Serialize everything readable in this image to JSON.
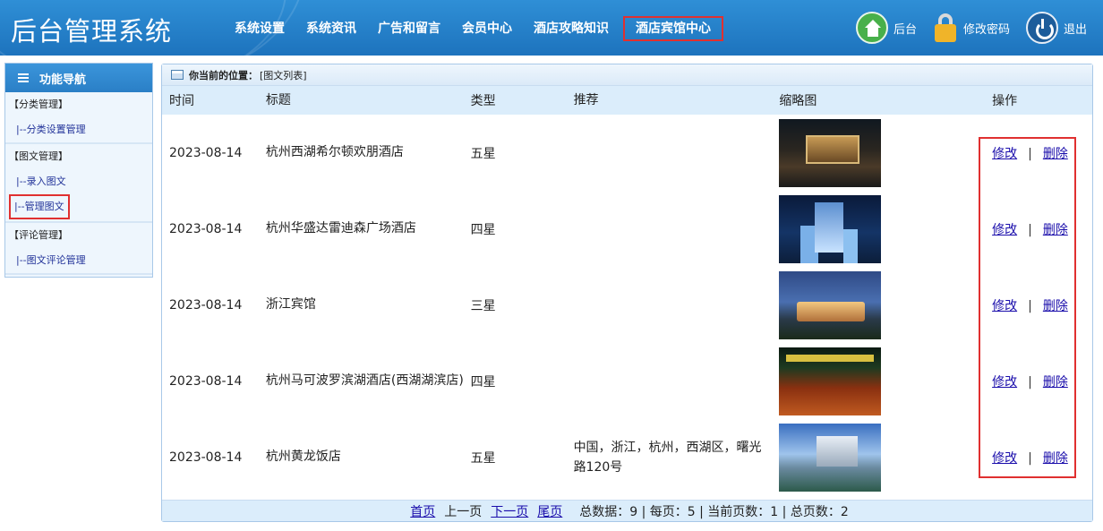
{
  "header": {
    "title": "后台管理系统",
    "nav": [
      "系统设置",
      "系统资讯",
      "广告和留言",
      "会员中心",
      "酒店攻略知识",
      "酒店宾馆中心"
    ],
    "tools": {
      "home": "后台",
      "password": "修改密码",
      "logout": "退出"
    }
  },
  "sidebar": {
    "title": "功能导航",
    "groups": [
      {
        "category": "【分类管理】",
        "links": [
          "|--分类设置管理"
        ]
      },
      {
        "category": "【图文管理】",
        "links": [
          "|--录入图文",
          "|--管理图文"
        ]
      },
      {
        "category": "【评论管理】",
        "links": [
          "|--图文评论管理"
        ]
      }
    ]
  },
  "breadcrumb": {
    "label": "你当前的位置：",
    "value": "[图文列表]"
  },
  "table": {
    "headers": [
      "时间",
      "标题",
      "类型",
      "推荐",
      "缩略图",
      "操作"
    ],
    "rows": [
      {
        "time": "2023-08-14",
        "title": "杭州西湖希尔顿欢朋酒店",
        "type": "五星",
        "recommend": ""
      },
      {
        "time": "2023-08-14",
        "title": "杭州华盛达雷迪森广场酒店",
        "type": "四星",
        "recommend": ""
      },
      {
        "time": "2023-08-14",
        "title": "浙江宾馆",
        "type": "三星",
        "recommend": ""
      },
      {
        "time": "2023-08-14",
        "title": "杭州马可波罗滨湖酒店(西湖湖滨店)",
        "type": "四星",
        "recommend": ""
      },
      {
        "time": "2023-08-14",
        "title": "杭州黄龙饭店",
        "type": "五星",
        "recommend": "中国，浙江，杭州，西湖区，曙光路120号"
      }
    ],
    "ops": {
      "edit": "修改",
      "sep": "|",
      "delete": "删除"
    }
  },
  "pager": {
    "first": "首页",
    "prev": "上一页",
    "next": "下一页",
    "last": "尾页",
    "stats": "总数据：9 | 每页：5 | 当前页数：1 | 总页数：2"
  }
}
